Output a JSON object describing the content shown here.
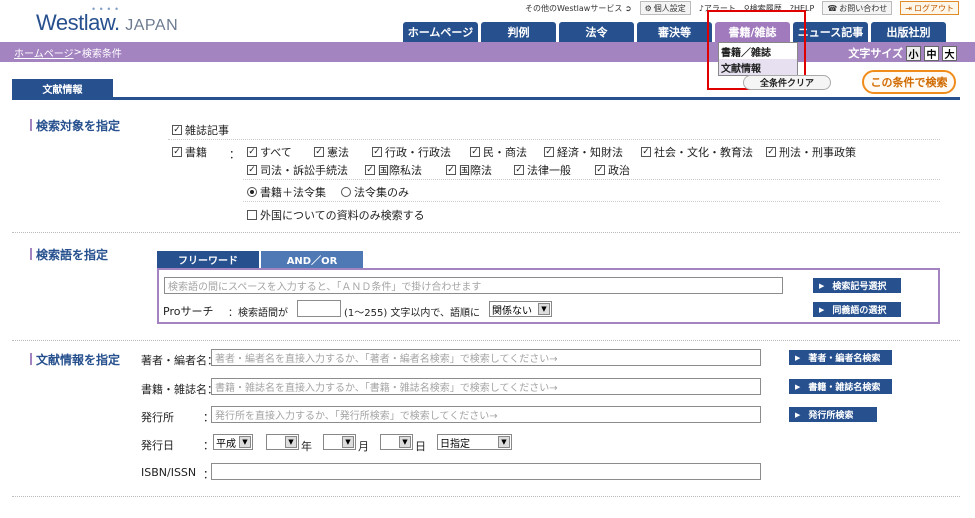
{
  "header": {
    "logo": "Westlaw.",
    "logo_sub": "JAPAN",
    "util": {
      "other_services": "その他のWestlawサービス",
      "personal": "個人設定",
      "alert": "アラート",
      "history": "検索履歴",
      "help": "HELP",
      "contact": "お問い合わせ",
      "logout": "ログアウト"
    },
    "nav_tabs": [
      "ホームページ",
      "判例",
      "法令",
      "審決等",
      "書籍/雑誌",
      "ニュース記事",
      "出版社別"
    ],
    "breadcrumb_home": "ホームページ",
    "breadcrumb_sep": " > ",
    "breadcrumb_current": "検索条件",
    "font_size_label": "文字サイズ",
    "font_sizes": [
      "小",
      "中",
      "大"
    ]
  },
  "dropdown": {
    "items": [
      "書籍／雑誌",
      "文献情報"
    ]
  },
  "top": {
    "section_tab": "文献情報",
    "clear_all": "全条件クリア",
    "search_button": "この条件で検索"
  },
  "target": {
    "label": "検索対象を指定",
    "magazine": "雑誌記事",
    "books": "書籍",
    "colon": "：",
    "categories": [
      "すべて",
      "憲法",
      "行政・行政法",
      "民・商法",
      "経済・知財法",
      "社会・文化・教育法",
      "刑法・刑事政策",
      "司法・訴訟手続法",
      "国際私法",
      "国際法",
      "法律一般",
      "政治"
    ],
    "radio_1": "書籍＋法令集",
    "radio_2": "法令集のみ",
    "foreign_only": "外国についての資料のみ検索する"
  },
  "keyword": {
    "label": "検索語を指定",
    "tab_free": "フリーワード",
    "tab_andor": "AND／OR",
    "placeholder": "検索語の間にスペースを入力すると、「ＡＮＤ条件」で掛け合わせます",
    "btn_code": "検索記号選択",
    "pro_label": "Proサーチ",
    "pro_text_1": "：検索語間が",
    "pro_text_2": "(1〜255) 文字以内で、語順に",
    "order_select": "関係ない",
    "btn_synonym": "同義語の選択"
  },
  "biblio": {
    "label": "文献情報を指定",
    "author_label": "著者・編者名：",
    "author_placeholder": "著者・編者名を直接入力するか、「著者・編者名検索」で検索してください→",
    "author_btn": "著者・編者名検索",
    "title_label": "書籍・雑誌名：",
    "title_placeholder": "書籍・雑誌名を直接入力するか、「書籍・雑誌名検索」で検索してください→",
    "title_btn": "書籍・雑誌名検索",
    "publisher_label": "発行所",
    "publisher_placeholder": "発行所を直接入力するか、「発行所検索」で検索してください→",
    "publisher_btn": "発行所検索",
    "date_label": "発行日",
    "era": "平成",
    "year": "年",
    "month": "月",
    "day": "日",
    "date_mode": "日指定",
    "isbn_label": "ISBN/ISSN"
  }
}
